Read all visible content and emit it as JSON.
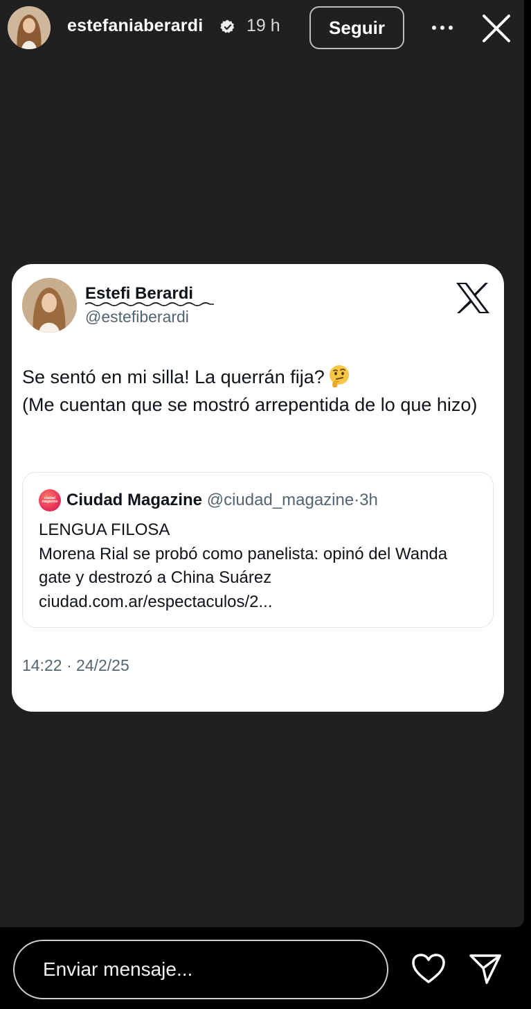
{
  "header": {
    "username": "estefaniaberardi",
    "time_ago": "19 h",
    "follow_label": "Seguir",
    "icons": [
      "verified-badge-icon",
      "more-options-icon",
      "close-icon"
    ]
  },
  "tweet": {
    "display_name": "Estefi Berardi",
    "handle": "@estefiberardi",
    "text_line1": "Se sentó en mi silla! La querrán fija?",
    "emoji": "thinking-face-emoji",
    "text_line2": "(Me cuentan que se mostró arrepentida de lo que hizo)",
    "platform_icon": "x-logo-icon",
    "quote": {
      "name": "Ciudad Magazine",
      "handle": "@ciudad_magazine",
      "separator": "·",
      "time": "3h",
      "line1": "LENGUA FILOSA",
      "line2": "Morena Rial se probó como panelista: opinó del Wanda gate y destrozó a China Suárez",
      "link": "ciudad.com.ar/espectaculos/2..."
    },
    "timestamp": "14:22 · 24/2/25"
  },
  "footer": {
    "message_placeholder": "Enviar mensaje...",
    "icons": [
      "heart-icon",
      "send-icon"
    ]
  },
  "colors": {
    "story_background": "#202020",
    "card_background": "#ffffff",
    "secondary_text": "#536471",
    "quote_logo": "#e8325a"
  }
}
